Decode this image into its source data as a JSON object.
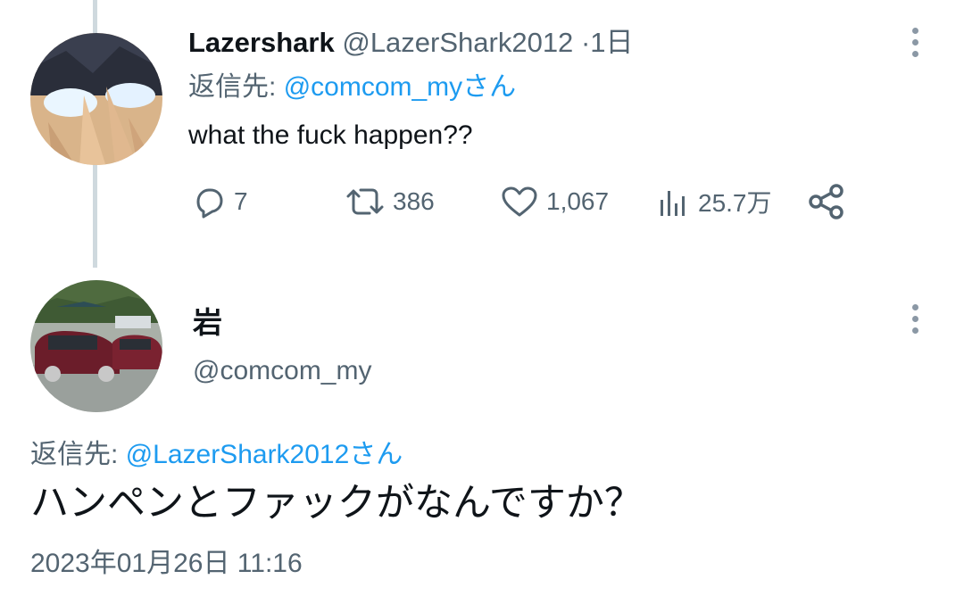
{
  "tweet1": {
    "display_name": "Lazershark",
    "handle": "@LazerShark2012",
    "separator": "·",
    "time": "1日",
    "reply_prefix": "返信先:",
    "reply_mention": "@comcom_myさん",
    "text": "what the fuck happen??",
    "actions": {
      "replies": "7",
      "retweets": "386",
      "likes": "1,067",
      "views": "25.7万"
    },
    "icons": [
      "reply-icon",
      "retweet-icon",
      "like-icon",
      "views-icon",
      "share-icon",
      "more-icon"
    ]
  },
  "tweet2": {
    "display_name": "岩",
    "handle": "@comcom_my",
    "reply_prefix": "返信先:",
    "reply_mention": "@LazerShark2012さん",
    "text": "ハンペンとファックがなんですか？",
    "timestamp": "2023年01月26日 11:16"
  },
  "colors": {
    "text": "#0f1419",
    "secondary": "#536471",
    "link": "#1d9bf0",
    "thread_line": "#cfd9de"
  }
}
